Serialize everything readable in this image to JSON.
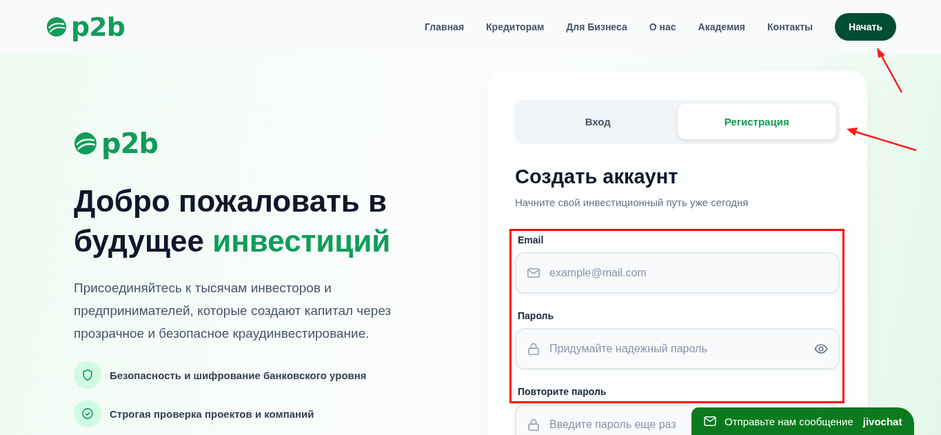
{
  "header": {
    "logo": "p2b",
    "nav": [
      "Главная",
      "Кредиторам",
      "Для Бизнеса",
      "О нас",
      "Академия",
      "Контакты"
    ],
    "cta": "Начать"
  },
  "hero": {
    "logo": "p2b",
    "heading_lead": "Добро пожаловать в будущее",
    "heading_accent": "инвестиций",
    "text": "Присоединяйтесь к тысячам инвесторов и предпринимателей, которые создают капитал через прозрачное и безопасное краудинвестирование.",
    "features": [
      {
        "kind": "shield",
        "text": "Безопасность и шифрование банковского уровня"
      },
      {
        "kind": "check",
        "text": "Строгая проверка проектов и компаний"
      }
    ]
  },
  "auth": {
    "tabs": [
      {
        "label": "Вход",
        "selected": false
      },
      {
        "label": "Регистрация",
        "selected": true
      }
    ],
    "title": "Создать аккаунт",
    "subtitle": "Начните свой инвестиционный путь уже сегодня",
    "fields": [
      {
        "kind": "email",
        "label": "Email",
        "placeholder": "example@mail.com"
      },
      {
        "kind": "password",
        "label": "Пароль",
        "placeholder": "Придумайте надежный пароль"
      },
      {
        "kind": "confirm",
        "label": "Повторите пароль",
        "placeholder": "Введите пароль еще раз"
      }
    ]
  },
  "chat_widget": {
    "text": "Отправьте нам сообщение",
    "brand": "jivochat"
  }
}
